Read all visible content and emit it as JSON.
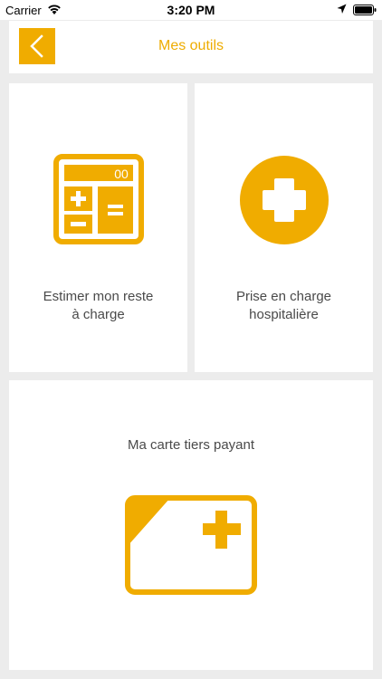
{
  "status_bar": {
    "carrier": "Carrier",
    "time": "3:20 PM"
  },
  "header": {
    "title": "Mes outils",
    "back_icon": "chevron-left-icon"
  },
  "tiles": [
    {
      "label_line1": "Estimer mon reste",
      "label_line2": "à charge",
      "icon": "calculator-icon"
    },
    {
      "label_line1": "Prise en charge",
      "label_line2": "hospitalière",
      "icon": "medical-cross-icon"
    },
    {
      "label_line1": "Ma carte tiers payant",
      "icon": "health-card-icon"
    }
  ],
  "calculator_display": "00",
  "colors": {
    "accent": "#f0ac00",
    "background": "#ececec",
    "text": "#4a4a4a"
  }
}
